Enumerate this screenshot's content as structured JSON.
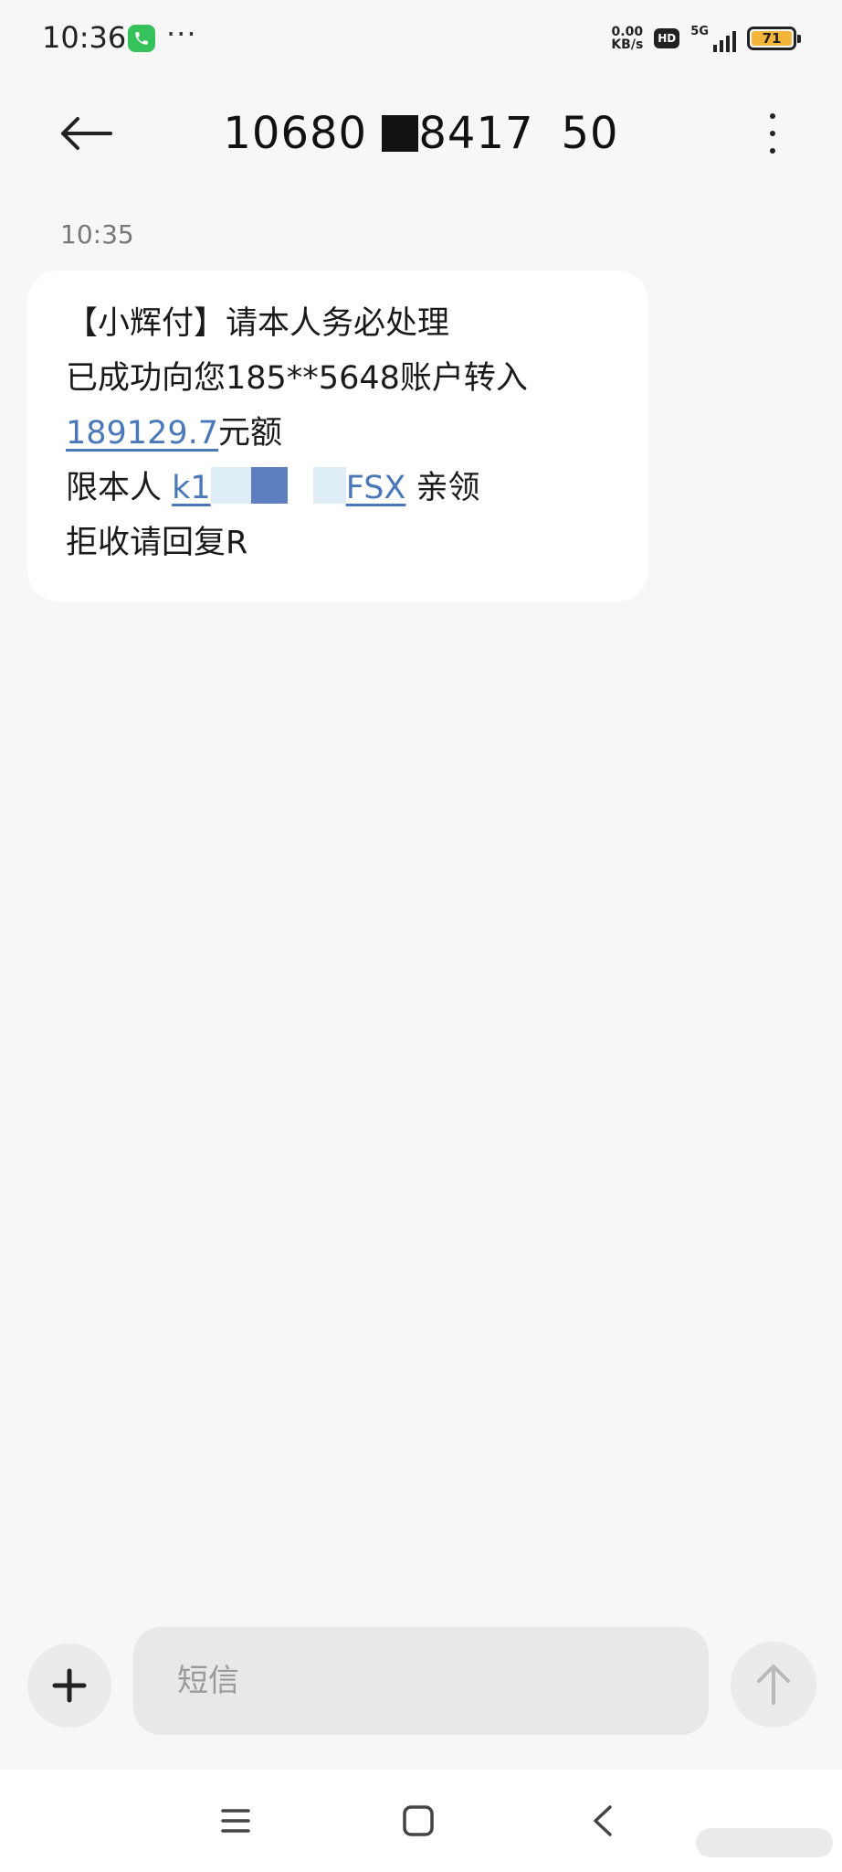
{
  "status_bar": {
    "time": "10:36",
    "more": "···",
    "net_speed_value": "0.00",
    "net_speed_unit": "KB/s",
    "hd": "HD",
    "network": "5G",
    "battery": "71",
    "battery_color": "#f4b63a"
  },
  "header": {
    "title_part1": "10680",
    "title_part2": "8417",
    "title_part3": "50"
  },
  "conversation": {
    "timestamp": "10:35",
    "message": {
      "line1": "【小辉付】请本人务必处理",
      "line2": "已成功向您185**5648账户转入",
      "amount": "189129.7",
      "amount_suffix": "元额",
      "line4_prefix": "限本人 ",
      "link_start": "k1",
      "link_end": "FSX",
      "line4_suffix": " 亲领",
      "line5": "拒收请回复R"
    },
    "link_color": "#4a78b8"
  },
  "composer": {
    "placeholder": "短信"
  }
}
